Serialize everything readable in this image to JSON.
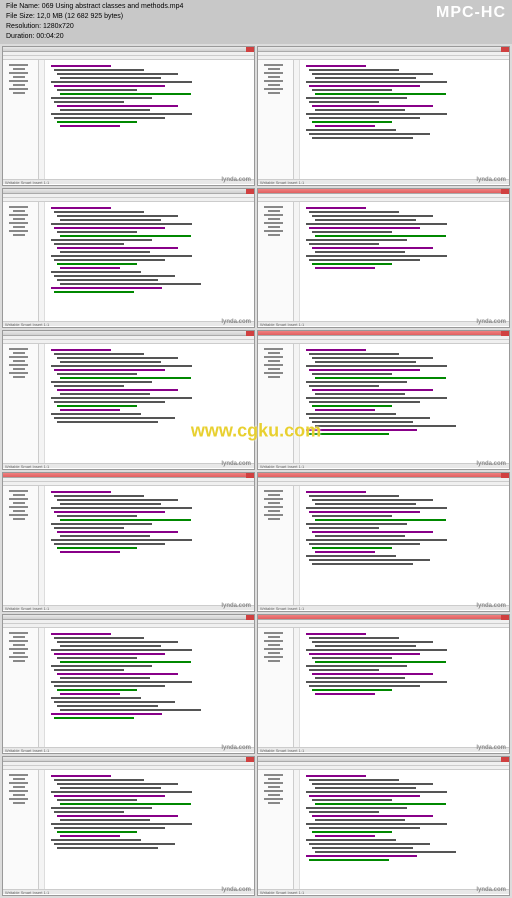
{
  "header": {
    "file_name_label": "File Name:",
    "file_name": "069 Using abstract classes and methods.mp4",
    "file_size_label": "File Size:",
    "file_size": "12,0 MB (12 682 925 bytes)",
    "resolution_label": "Resolution:",
    "resolution": "1280x720",
    "duration_label": "Duration:",
    "duration": "00:04:20",
    "player": "MPC-HC"
  },
  "watermarks": {
    "center": "www.cgku.com",
    "thumb": "lynda.com"
  },
  "thumbs": [
    {
      "id": 1,
      "red_bar": false
    },
    {
      "id": 2,
      "red_bar": false
    },
    {
      "id": 3,
      "red_bar": false
    },
    {
      "id": 4,
      "red_bar": true
    },
    {
      "id": 5,
      "red_bar": false
    },
    {
      "id": 6,
      "red_bar": true
    },
    {
      "id": 7,
      "red_bar": true
    },
    {
      "id": 8,
      "red_bar": true
    },
    {
      "id": 9,
      "red_bar": false
    },
    {
      "id": 10,
      "red_bar": true
    },
    {
      "id": 11,
      "red_bar": false
    },
    {
      "id": 12,
      "red_bar": false
    }
  ],
  "status_text": "Writable  Smart Insert  1:1"
}
